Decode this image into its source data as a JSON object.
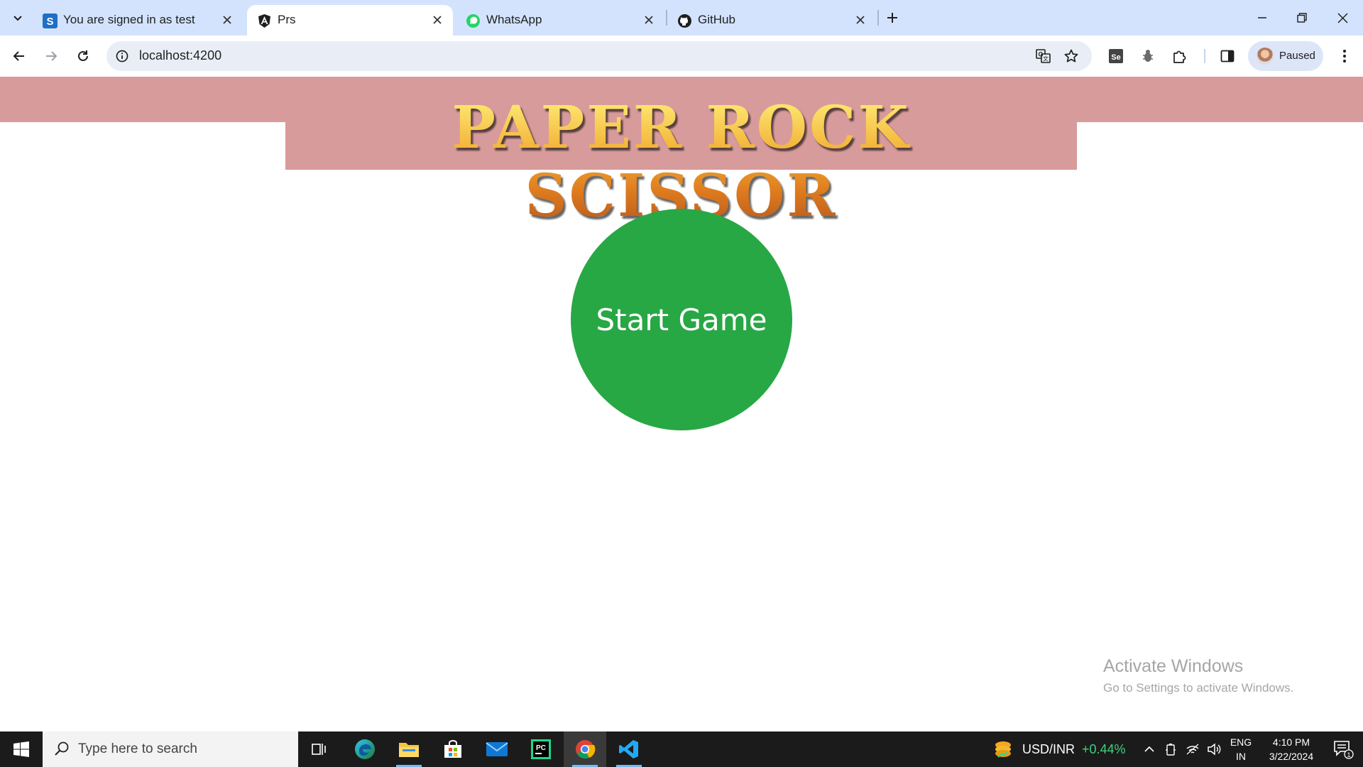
{
  "browser": {
    "tabs": [
      {
        "title": "You are signed in as test",
        "icon": "s-brand-icon"
      },
      {
        "title": "Prs",
        "icon": "angular-icon"
      },
      {
        "title": "WhatsApp",
        "icon": "whatsapp-icon"
      },
      {
        "title": "GitHub",
        "icon": "github-icon"
      }
    ],
    "url": "localhost:4200",
    "profile_label": "Paused"
  },
  "page": {
    "banner_title": "PAPER ROCK SCISSOR",
    "start_button_label": "Start Game",
    "colors": {
      "banner": "#d89b9b",
      "button": "#28a745"
    }
  },
  "watermark": {
    "title": "Activate Windows",
    "subtitle": "Go to Settings to activate Windows."
  },
  "taskbar": {
    "search_placeholder": "Type here to search",
    "ticker_symbol": "USD/INR",
    "ticker_change": "+0.44%",
    "lang_line1": "ENG",
    "lang_line2": "IN",
    "time": "4:10 PM",
    "date": "3/22/2024",
    "notification_count": "1"
  }
}
